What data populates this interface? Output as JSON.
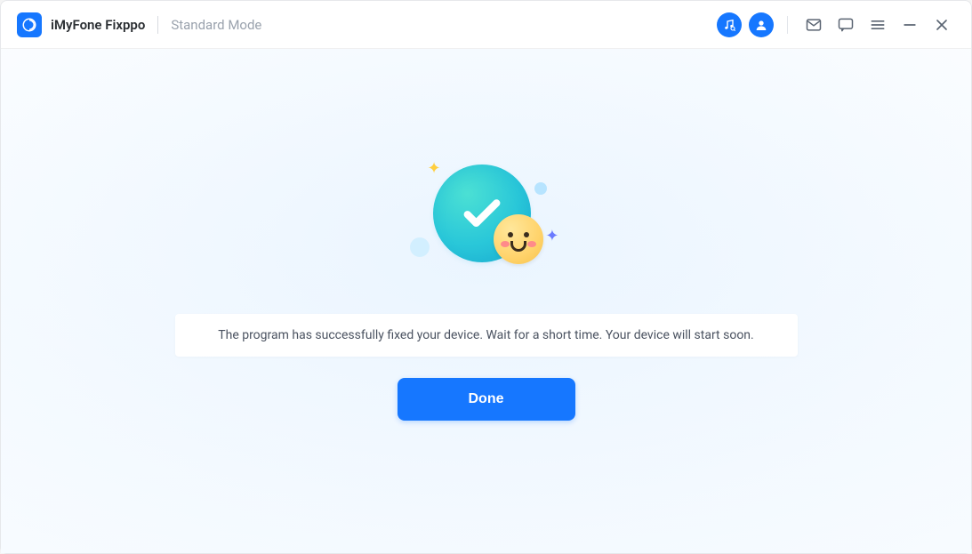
{
  "app": {
    "title": "iMyFone Fixppo",
    "mode": "Standard Mode"
  },
  "main": {
    "message": "The program has successfully fixed your device. Wait for a short time. Your device will start soon.",
    "done_label": "Done"
  },
  "icons": {
    "music": "music-search-icon",
    "account": "account-icon",
    "mail": "mail-icon",
    "chat": "chat-icon",
    "menu": "menu-icon",
    "minimize": "minimize-icon",
    "close": "close-icon"
  },
  "colors": {
    "primary": "#1677ff",
    "muted_text": "#9aa2ad"
  }
}
